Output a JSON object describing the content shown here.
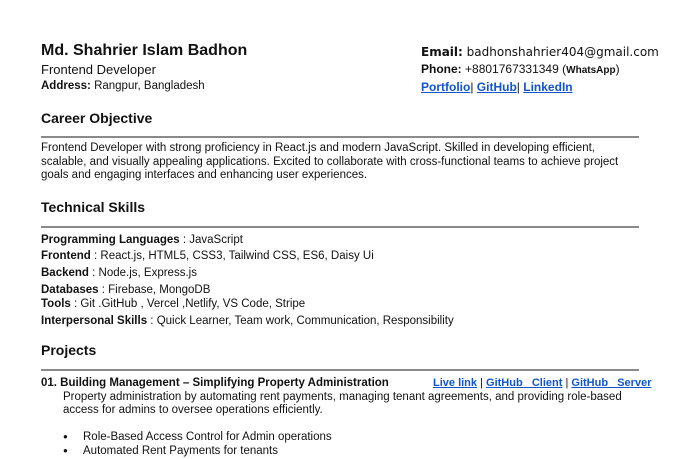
{
  "header": {
    "name": "Md. Shahrier Islam Badhon",
    "role": "Frontend Developer",
    "address_label": "Address:",
    "address_value": "Rangpur, Bangladesh",
    "email_label": "Email:",
    "email_value": "badhonshahrier404@gmail.com",
    "phone_label": "Phone:",
    "phone_value": "+8801767331349",
    "phone_open": "(",
    "phone_note": "WhatsApp",
    "phone_close": ")",
    "links": [
      "Portfolio",
      "GitHub",
      "LinkedIn"
    ],
    "separator": "|",
    "link_color": "#1155cc"
  },
  "career": {
    "heading": "Career Objective",
    "text": "Frontend Developer with strong proficiency in React.js and modern JavaScript. Skilled in developing efficient, scalable, and visually appealing applications. Excited to collaborate with cross-functional teams to achieve project goals and engaging interfaces and enhancing user experiences."
  },
  "skills": {
    "heading": "Technical Skills",
    "items": [
      {
        "label": "Programming Languages",
        "sep": " : ",
        "value": "JavaScript"
      },
      {
        "label": "Frontend",
        "sep": " : ",
        "value": "React.js, HTML5, CSS3, Tailwind CSS, ES6, Daisy Ui"
      },
      {
        "label": "Backend",
        "sep": " : ",
        "value": "Node.js, Express.js"
      },
      {
        "label": "Databases",
        "sep": " : ",
        "value": "Firebase, MongoDB"
      },
      {
        "label": "Tools",
        "sep": " : ",
        "value": "Git .GitHub , Vercel ,Netlify, VS Code, Stripe"
      },
      {
        "label": "Interpersonal Skills",
        "sep": " : ",
        "value": "Quick Learner, Team work, Communication, Responsibility"
      }
    ]
  },
  "projects": {
    "heading": "Projects",
    "items": [
      {
        "title": "01. Building Management – Simplifying Property Administration",
        "links": [
          "Live link",
          "GitHub _Client",
          "GitHub _Server"
        ],
        "description": "Property administration by automating rent payments, managing tenant agreements, and providing role-based access for admins to oversee operations efficiently.",
        "bullets": [
          "Role-Based Access Control for Admin operations",
          "Automated Rent Payments for tenants"
        ]
      }
    ]
  }
}
